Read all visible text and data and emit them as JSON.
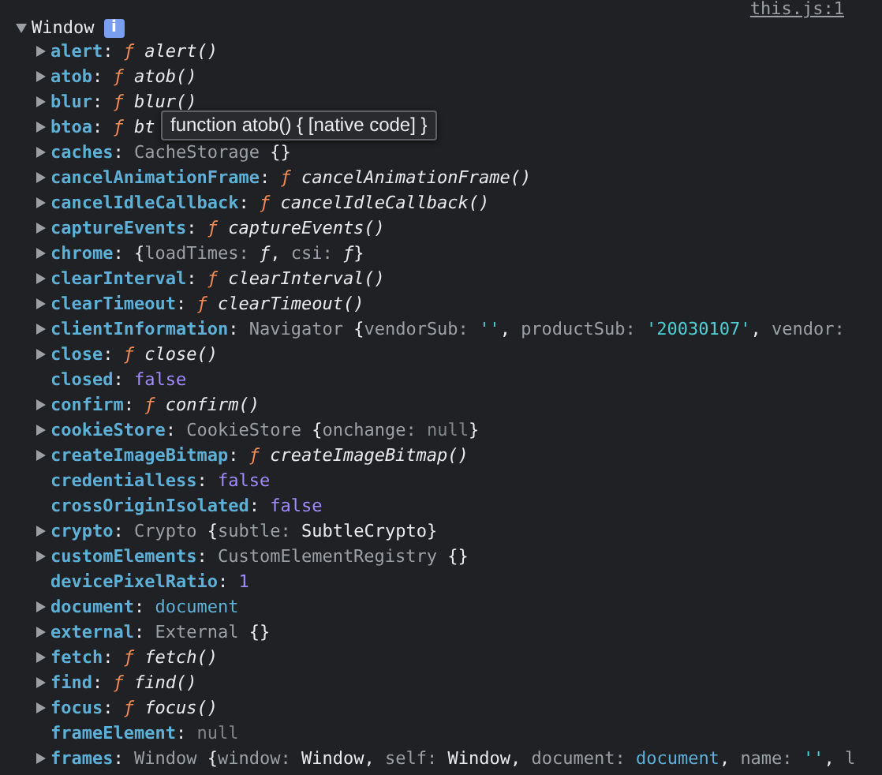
{
  "source_link": "this.js:1",
  "object": {
    "label": "Window",
    "badge": "i",
    "expanded": true
  },
  "tooltip": {
    "text": "function atob() { [native code] }"
  },
  "properties": [
    {
      "name": "alert",
      "expandable": true,
      "value": [
        {
          "kind": "punct",
          "text": ": "
        },
        {
          "kind": "fsym",
          "text": "ƒ"
        },
        {
          "kind": "call",
          "text": " alert()"
        }
      ]
    },
    {
      "name": "atob",
      "expandable": true,
      "value": [
        {
          "kind": "punct",
          "text": ": "
        },
        {
          "kind": "fsym",
          "text": "ƒ"
        },
        {
          "kind": "call",
          "text": " atob()"
        }
      ]
    },
    {
      "name": "blur",
      "expandable": true,
      "value": [
        {
          "kind": "punct",
          "text": ": "
        },
        {
          "kind": "fsym",
          "text": "ƒ"
        },
        {
          "kind": "call",
          "text": " blur()"
        }
      ]
    },
    {
      "name": "btoa",
      "expandable": true,
      "value": [
        {
          "kind": "punct",
          "text": ": "
        },
        {
          "kind": "fsym",
          "text": "ƒ"
        },
        {
          "kind": "call",
          "text": " bt"
        }
      ]
    },
    {
      "name": "caches",
      "expandable": true,
      "value": [
        {
          "kind": "punct",
          "text": ": "
        },
        {
          "kind": "type",
          "text": "CacheStorage "
        },
        {
          "kind": "punct",
          "text": "{}"
        }
      ]
    },
    {
      "name": "cancelAnimationFrame",
      "expandable": true,
      "value": [
        {
          "kind": "punct",
          "text": ": "
        },
        {
          "kind": "fsym",
          "text": "ƒ"
        },
        {
          "kind": "call",
          "text": " cancelAnimationFrame()"
        }
      ]
    },
    {
      "name": "cancelIdleCallback",
      "expandable": true,
      "value": [
        {
          "kind": "punct",
          "text": ": "
        },
        {
          "kind": "fsym",
          "text": "ƒ"
        },
        {
          "kind": "call",
          "text": " cancelIdleCallback()"
        }
      ]
    },
    {
      "name": "captureEvents",
      "expandable": true,
      "value": [
        {
          "kind": "punct",
          "text": ": "
        },
        {
          "kind": "fsym",
          "text": "ƒ"
        },
        {
          "kind": "call",
          "text": " captureEvents()"
        }
      ]
    },
    {
      "name": "chrome",
      "expandable": true,
      "value": [
        {
          "kind": "punct",
          "text": ": {"
        },
        {
          "kind": "key",
          "text": "loadTimes: "
        },
        {
          "kind": "fplain",
          "text": "ƒ"
        },
        {
          "kind": "punct",
          "text": ", "
        },
        {
          "kind": "key",
          "text": "csi: "
        },
        {
          "kind": "fplain",
          "text": "ƒ"
        },
        {
          "kind": "punct",
          "text": "}"
        }
      ]
    },
    {
      "name": "clearInterval",
      "expandable": true,
      "value": [
        {
          "kind": "punct",
          "text": ": "
        },
        {
          "kind": "fsym",
          "text": "ƒ"
        },
        {
          "kind": "call",
          "text": " clearInterval()"
        }
      ]
    },
    {
      "name": "clearTimeout",
      "expandable": true,
      "value": [
        {
          "kind": "punct",
          "text": ": "
        },
        {
          "kind": "fsym",
          "text": "ƒ"
        },
        {
          "kind": "call",
          "text": " clearTimeout()"
        }
      ]
    },
    {
      "name": "clientInformation",
      "expandable": true,
      "value": [
        {
          "kind": "punct",
          "text": ": "
        },
        {
          "kind": "type",
          "text": "Navigator "
        },
        {
          "kind": "punct",
          "text": "{"
        },
        {
          "kind": "key",
          "text": "vendorSub: "
        },
        {
          "kind": "string",
          "text": "''"
        },
        {
          "kind": "punct",
          "text": ", "
        },
        {
          "kind": "key",
          "text": "productSub: "
        },
        {
          "kind": "string",
          "text": "'20030107'"
        },
        {
          "kind": "punct",
          "text": ", "
        },
        {
          "kind": "key",
          "text": "vendor:"
        }
      ]
    },
    {
      "name": "close",
      "expandable": true,
      "value": [
        {
          "kind": "punct",
          "text": ": "
        },
        {
          "kind": "fsym",
          "text": "ƒ"
        },
        {
          "kind": "call",
          "text": " close()"
        }
      ]
    },
    {
      "name": "closed",
      "expandable": false,
      "value": [
        {
          "kind": "punct",
          "text": ": "
        },
        {
          "kind": "literal",
          "text": "false"
        }
      ]
    },
    {
      "name": "confirm",
      "expandable": true,
      "value": [
        {
          "kind": "punct",
          "text": ": "
        },
        {
          "kind": "fsym",
          "text": "ƒ"
        },
        {
          "kind": "call",
          "text": " confirm()"
        }
      ]
    },
    {
      "name": "cookieStore",
      "expandable": true,
      "value": [
        {
          "kind": "punct",
          "text": ": "
        },
        {
          "kind": "type",
          "text": "CookieStore "
        },
        {
          "kind": "punct",
          "text": "{"
        },
        {
          "kind": "key",
          "text": "onchange: "
        },
        {
          "kind": "null",
          "text": "null"
        },
        {
          "kind": "punct",
          "text": "}"
        }
      ]
    },
    {
      "name": "createImageBitmap",
      "expandable": true,
      "value": [
        {
          "kind": "punct",
          "text": ": "
        },
        {
          "kind": "fsym",
          "text": "ƒ"
        },
        {
          "kind": "call",
          "text": " createImageBitmap()"
        }
      ]
    },
    {
      "name": "credentialless",
      "expandable": false,
      "value": [
        {
          "kind": "punct",
          "text": ": "
        },
        {
          "kind": "literal",
          "text": "false"
        }
      ]
    },
    {
      "name": "crossOriginIsolated",
      "expandable": false,
      "value": [
        {
          "kind": "punct",
          "text": ": "
        },
        {
          "kind": "literal",
          "text": "false"
        }
      ]
    },
    {
      "name": "crypto",
      "expandable": true,
      "value": [
        {
          "kind": "punct",
          "text": ": "
        },
        {
          "kind": "type",
          "text": "Crypto "
        },
        {
          "kind": "punct",
          "text": "{"
        },
        {
          "kind": "key",
          "text": "subtle: "
        },
        {
          "kind": "plain",
          "text": "SubtleCrypto"
        },
        {
          "kind": "punct",
          "text": "}"
        }
      ]
    },
    {
      "name": "customElements",
      "expandable": true,
      "value": [
        {
          "kind": "punct",
          "text": ": "
        },
        {
          "kind": "type",
          "text": "CustomElementRegistry "
        },
        {
          "kind": "punct",
          "text": "{}"
        }
      ]
    },
    {
      "name": "devicePixelRatio",
      "expandable": false,
      "value": [
        {
          "kind": "punct",
          "text": ": "
        },
        {
          "kind": "literal",
          "text": "1"
        }
      ]
    },
    {
      "name": "document",
      "expandable": true,
      "value": [
        {
          "kind": "punct",
          "text": ": "
        },
        {
          "kind": "node",
          "text": "document"
        }
      ]
    },
    {
      "name": "external",
      "expandable": true,
      "value": [
        {
          "kind": "punct",
          "text": ": "
        },
        {
          "kind": "type",
          "text": "External "
        },
        {
          "kind": "punct",
          "text": "{}"
        }
      ]
    },
    {
      "name": "fetch",
      "expandable": true,
      "value": [
        {
          "kind": "punct",
          "text": ": "
        },
        {
          "kind": "fsym",
          "text": "ƒ"
        },
        {
          "kind": "call",
          "text": " fetch()"
        }
      ]
    },
    {
      "name": "find",
      "expandable": true,
      "value": [
        {
          "kind": "punct",
          "text": ": "
        },
        {
          "kind": "fsym",
          "text": "ƒ"
        },
        {
          "kind": "call",
          "text": " find()"
        }
      ]
    },
    {
      "name": "focus",
      "expandable": true,
      "value": [
        {
          "kind": "punct",
          "text": ": "
        },
        {
          "kind": "fsym",
          "text": "ƒ"
        },
        {
          "kind": "call",
          "text": " focus()"
        }
      ]
    },
    {
      "name": "frameElement",
      "expandable": false,
      "value": [
        {
          "kind": "punct",
          "text": ": "
        },
        {
          "kind": "null",
          "text": "null"
        }
      ]
    },
    {
      "name": "frames",
      "expandable": true,
      "value": [
        {
          "kind": "punct",
          "text": ": "
        },
        {
          "kind": "type",
          "text": "Window "
        },
        {
          "kind": "punct",
          "text": "{"
        },
        {
          "kind": "key",
          "text": "window: "
        },
        {
          "kind": "plain",
          "text": "Window"
        },
        {
          "kind": "punct",
          "text": ", "
        },
        {
          "kind": "key",
          "text": "self: "
        },
        {
          "kind": "plain",
          "text": "Window"
        },
        {
          "kind": "punct",
          "text": ", "
        },
        {
          "kind": "key",
          "text": "document: "
        },
        {
          "kind": "node",
          "text": "document"
        },
        {
          "kind": "punct",
          "text": ", "
        },
        {
          "kind": "key",
          "text": "name: "
        },
        {
          "kind": "string",
          "text": "''"
        },
        {
          "kind": "punct",
          "text": ", "
        },
        {
          "kind": "key",
          "text": "l"
        }
      ]
    }
  ]
}
